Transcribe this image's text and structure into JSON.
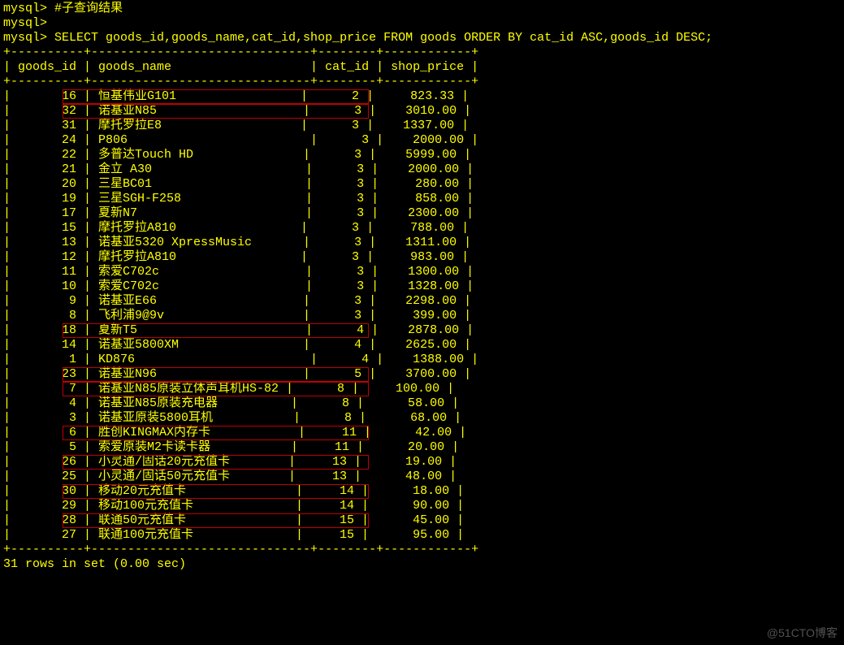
{
  "prompt": "mysql> ",
  "comment_line": "#子查询结果",
  "empty_prompt": "mysql> ",
  "query": "SELECT goods_id,goods_name,cat_id,shop_price FROM goods ORDER BY cat_id ASC,goods_id DESC;",
  "sep": "+----------+------------------------------+--------+------------+",
  "header": "| goods_id | goods_name                   | cat_id | shop_price |",
  "footer": "31 rows in set (0.00 sec)",
  "watermark": "@51CTO博客",
  "rows": [
    {
      "goods_id": 16,
      "goods_name": "恒基伟业G101",
      "cat_id": 2,
      "shop_price": "823.33",
      "hl": true
    },
    {
      "goods_id": 32,
      "goods_name": "诺基亚N85",
      "cat_id": 3,
      "shop_price": "3010.00",
      "hl": true
    },
    {
      "goods_id": 31,
      "goods_name": "摩托罗拉E8",
      "cat_id": 3,
      "shop_price": "1337.00"
    },
    {
      "goods_id": 24,
      "goods_name": "P806",
      "cat_id": 3,
      "shop_price": "2000.00"
    },
    {
      "goods_id": 22,
      "goods_name": "多普达Touch HD",
      "cat_id": 3,
      "shop_price": "5999.00"
    },
    {
      "goods_id": 21,
      "goods_name": "金立 A30",
      "cat_id": 3,
      "shop_price": "2000.00"
    },
    {
      "goods_id": 20,
      "goods_name": "三星BC01",
      "cat_id": 3,
      "shop_price": "280.00"
    },
    {
      "goods_id": 19,
      "goods_name": "三星SGH-F258",
      "cat_id": 3,
      "shop_price": "858.00"
    },
    {
      "goods_id": 17,
      "goods_name": "夏新N7",
      "cat_id": 3,
      "shop_price": "2300.00"
    },
    {
      "goods_id": 15,
      "goods_name": "摩托罗拉A810",
      "cat_id": 3,
      "shop_price": "788.00"
    },
    {
      "goods_id": 13,
      "goods_name": "诺基亚5320 XpressMusic",
      "cat_id": 3,
      "shop_price": "1311.00"
    },
    {
      "goods_id": 12,
      "goods_name": "摩托罗拉A810",
      "cat_id": 3,
      "shop_price": "983.00"
    },
    {
      "goods_id": 11,
      "goods_name": "索爱C702c",
      "cat_id": 3,
      "shop_price": "1300.00"
    },
    {
      "goods_id": 10,
      "goods_name": "索爱C702c",
      "cat_id": 3,
      "shop_price": "1328.00"
    },
    {
      "goods_id": 9,
      "goods_name": "诺基亚E66",
      "cat_id": 3,
      "shop_price": "2298.00"
    },
    {
      "goods_id": 8,
      "goods_name": "飞利浦9@9v",
      "cat_id": 3,
      "shop_price": "399.00"
    },
    {
      "goods_id": 18,
      "goods_name": "夏新T5",
      "cat_id": 4,
      "shop_price": "2878.00",
      "hl": true
    },
    {
      "goods_id": 14,
      "goods_name": "诺基亚5800XM",
      "cat_id": 4,
      "shop_price": "2625.00"
    },
    {
      "goods_id": 1,
      "goods_name": "KD876",
      "cat_id": 4,
      "shop_price": "1388.00"
    },
    {
      "goods_id": 23,
      "goods_name": "诺基亚N96",
      "cat_id": 5,
      "shop_price": "3700.00",
      "hl": true
    },
    {
      "goods_id": 7,
      "goods_name": "诺基亚N85原装立体声耳机HS-82",
      "cat_id": 8,
      "shop_price": "100.00",
      "hl": true
    },
    {
      "goods_id": 4,
      "goods_name": "诺基亚N85原装充电器",
      "cat_id": 8,
      "shop_price": "58.00"
    },
    {
      "goods_id": 3,
      "goods_name": "诺基亚原装5800耳机",
      "cat_id": 8,
      "shop_price": "68.00"
    },
    {
      "goods_id": 6,
      "goods_name": "胜创KINGMAX内存卡",
      "cat_id": 11,
      "shop_price": "42.00",
      "hl": true
    },
    {
      "goods_id": 5,
      "goods_name": "索爱原装M2卡读卡器",
      "cat_id": 11,
      "shop_price": "20.00"
    },
    {
      "goods_id": 26,
      "goods_name": "小灵通/固话20元充值卡",
      "cat_id": 13,
      "shop_price": "19.00",
      "hl": true
    },
    {
      "goods_id": 25,
      "goods_name": "小灵通/固话50元充值卡",
      "cat_id": 13,
      "shop_price": "48.00"
    },
    {
      "goods_id": 30,
      "goods_name": "移动20元充值卡",
      "cat_id": 14,
      "shop_price": "18.00",
      "hl": true
    },
    {
      "goods_id": 29,
      "goods_name": "移动100元充值卡",
      "cat_id": 14,
      "shop_price": "90.00"
    },
    {
      "goods_id": 28,
      "goods_name": "联通50元充值卡",
      "cat_id": 15,
      "shop_price": "45.00",
      "hl": true
    },
    {
      "goods_id": 27,
      "goods_name": "联通100元充值卡",
      "cat_id": 15,
      "shop_price": "95.00"
    }
  ],
  "chart_data": {
    "type": "table",
    "title": "goods ORDER BY cat_id ASC, goods_id DESC",
    "columns": [
      "goods_id",
      "goods_name",
      "cat_id",
      "shop_price"
    ],
    "rows": [
      [
        16,
        "恒基伟业G101",
        2,
        823.33
      ],
      [
        32,
        "诺基亚N85",
        3,
        3010.0
      ],
      [
        31,
        "摩托罗拉E8",
        3,
        1337.0
      ],
      [
        24,
        "P806",
        3,
        2000.0
      ],
      [
        22,
        "多普达Touch HD",
        3,
        5999.0
      ],
      [
        21,
        "金立 A30",
        3,
        2000.0
      ],
      [
        20,
        "三星BC01",
        3,
        280.0
      ],
      [
        19,
        "三星SGH-F258",
        3,
        858.0
      ],
      [
        17,
        "夏新N7",
        3,
        2300.0
      ],
      [
        15,
        "摩托罗拉A810",
        3,
        788.0
      ],
      [
        13,
        "诺基亚5320 XpressMusic",
        3,
        1311.0
      ],
      [
        12,
        "摩托罗拉A810",
        3,
        983.0
      ],
      [
        11,
        "索爱C702c",
        3,
        1300.0
      ],
      [
        10,
        "索爱C702c",
        3,
        1328.0
      ],
      [
        9,
        "诺基亚E66",
        3,
        2298.0
      ],
      [
        8,
        "飞利浦9@9v",
        3,
        399.0
      ],
      [
        18,
        "夏新T5",
        4,
        2878.0
      ],
      [
        14,
        "诺基亚5800XM",
        4,
        2625.0
      ],
      [
        1,
        "KD876",
        4,
        1388.0
      ],
      [
        23,
        "诺基亚N96",
        5,
        3700.0
      ],
      [
        7,
        "诺基亚N85原装立体声耳机HS-82",
        8,
        100.0
      ],
      [
        4,
        "诺基亚N85原装充电器",
        8,
        58.0
      ],
      [
        3,
        "诺基亚原装5800耳机",
        8,
        68.0
      ],
      [
        6,
        "胜创KINGMAX内存卡",
        11,
        42.0
      ],
      [
        5,
        "索爱原装M2卡读卡器",
        11,
        20.0
      ],
      [
        26,
        "小灵通/固话20元充值卡",
        13,
        19.0
      ],
      [
        25,
        "小灵通/固话50元充值卡",
        13,
        48.0
      ],
      [
        30,
        "移动20元充值卡",
        14,
        18.0
      ],
      [
        29,
        "移动100元充值卡",
        14,
        90.0
      ],
      [
        28,
        "联通50元充值卡",
        15,
        45.0
      ],
      [
        27,
        "联通100元充值卡",
        15,
        95.0
      ]
    ]
  }
}
